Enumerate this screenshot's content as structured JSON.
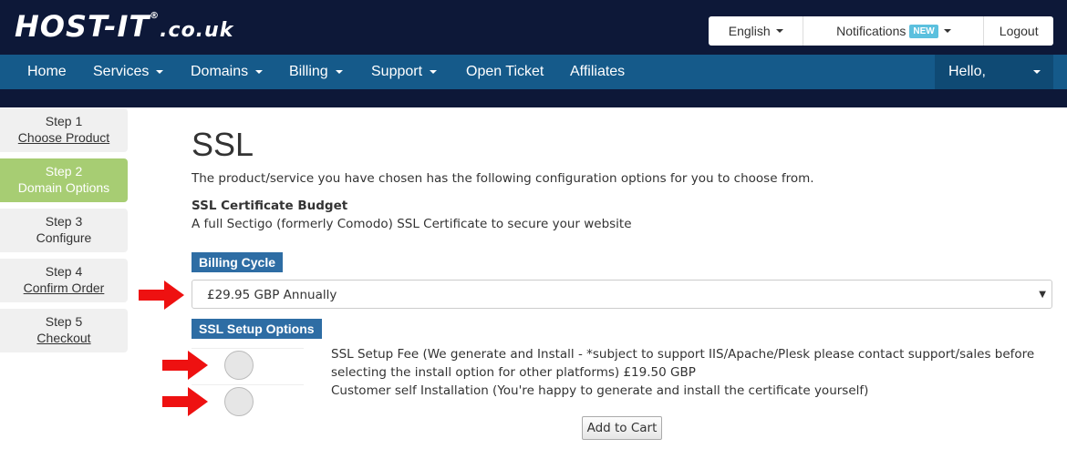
{
  "brand": {
    "logo_main": "HOST-IT",
    "logo_tld": ".co.uk",
    "logo_reg": "®"
  },
  "top_panel": {
    "language": "English",
    "notifications": "Notifications",
    "notifications_badge": "NEW",
    "logout": "Logout"
  },
  "nav": {
    "items": [
      {
        "label": "Home",
        "dropdown": false
      },
      {
        "label": "Services",
        "dropdown": true
      },
      {
        "label": "Domains",
        "dropdown": true
      },
      {
        "label": "Billing",
        "dropdown": true
      },
      {
        "label": "Support",
        "dropdown": true
      },
      {
        "label": "Open Ticket",
        "dropdown": false
      },
      {
        "label": "Affiliates",
        "dropdown": false
      }
    ],
    "hello": "Hello,"
  },
  "steps": [
    {
      "step": "Step 1",
      "label": "Choose Product",
      "state": "link"
    },
    {
      "step": "Step 2",
      "label": "Domain Options",
      "state": "active"
    },
    {
      "step": "Step 3",
      "label": "Configure",
      "state": "plain"
    },
    {
      "step": "Step 4",
      "label": "Confirm Order",
      "state": "link"
    },
    {
      "step": "Step 5",
      "label": "Checkout",
      "state": "link"
    }
  ],
  "main": {
    "title": "SSL",
    "intro": "The product/service you have chosen has the following configuration options for you to choose from.",
    "product_name": "SSL Certificate Budget",
    "product_desc": "A full Sectigo (formerly Comodo) SSL Certificate to secure your website",
    "billing_label": "Billing Cycle",
    "billing_selected": "£29.95 GBP Annually",
    "setup_label": "SSL Setup Options",
    "options": [
      {
        "label": "SSL Setup Fee (We generate and Install - *subject to support IIS/Apache/Plesk please contact support/sales before selecting the install option for other platforms) £19.50 GBP"
      },
      {
        "label": "Customer self Installation (You're happy to generate and install the certificate yourself)"
      }
    ],
    "add_to_cart": "Add to Cart"
  },
  "colors": {
    "topbar": "#0d1838",
    "navbar": "#155a8a",
    "active_step": "#a7cd73",
    "label_bg": "#2e6da4",
    "annotation_arrow": "#ee1111"
  }
}
